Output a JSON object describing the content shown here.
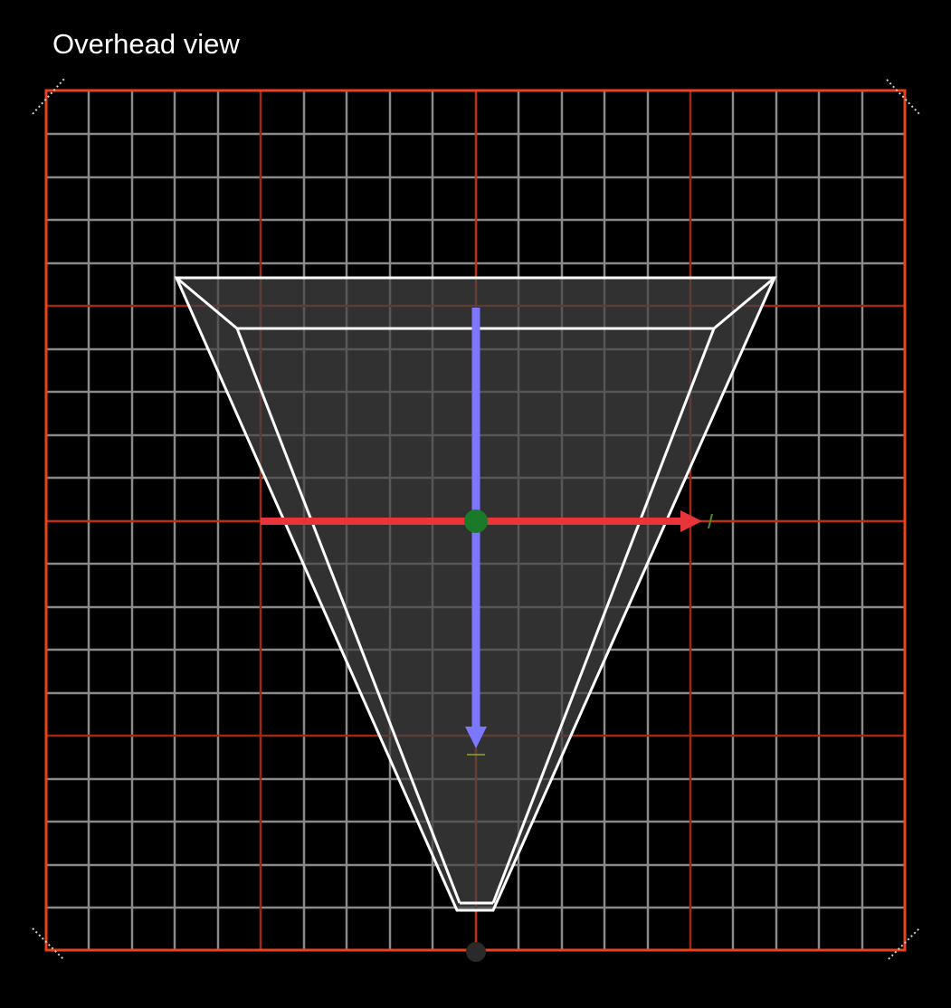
{
  "viewport": {
    "title": "Overhead view"
  },
  "colors": {
    "background": "#000000",
    "grid_minor": "#8a8a8a",
    "grid_major": "#a02a10",
    "frame": "#e8431a",
    "frustum_fill": "#444444",
    "frustum_edge": "#ffffff",
    "x_axis": "#e8343a",
    "z_axis": "#7b78ff",
    "pivot": "#1a7a2a"
  },
  "icons": {
    "pivot": "pivot-handle-icon",
    "x_axis": "x-axis-arrow-icon",
    "z_axis": "z-axis-arrow-icon"
  }
}
